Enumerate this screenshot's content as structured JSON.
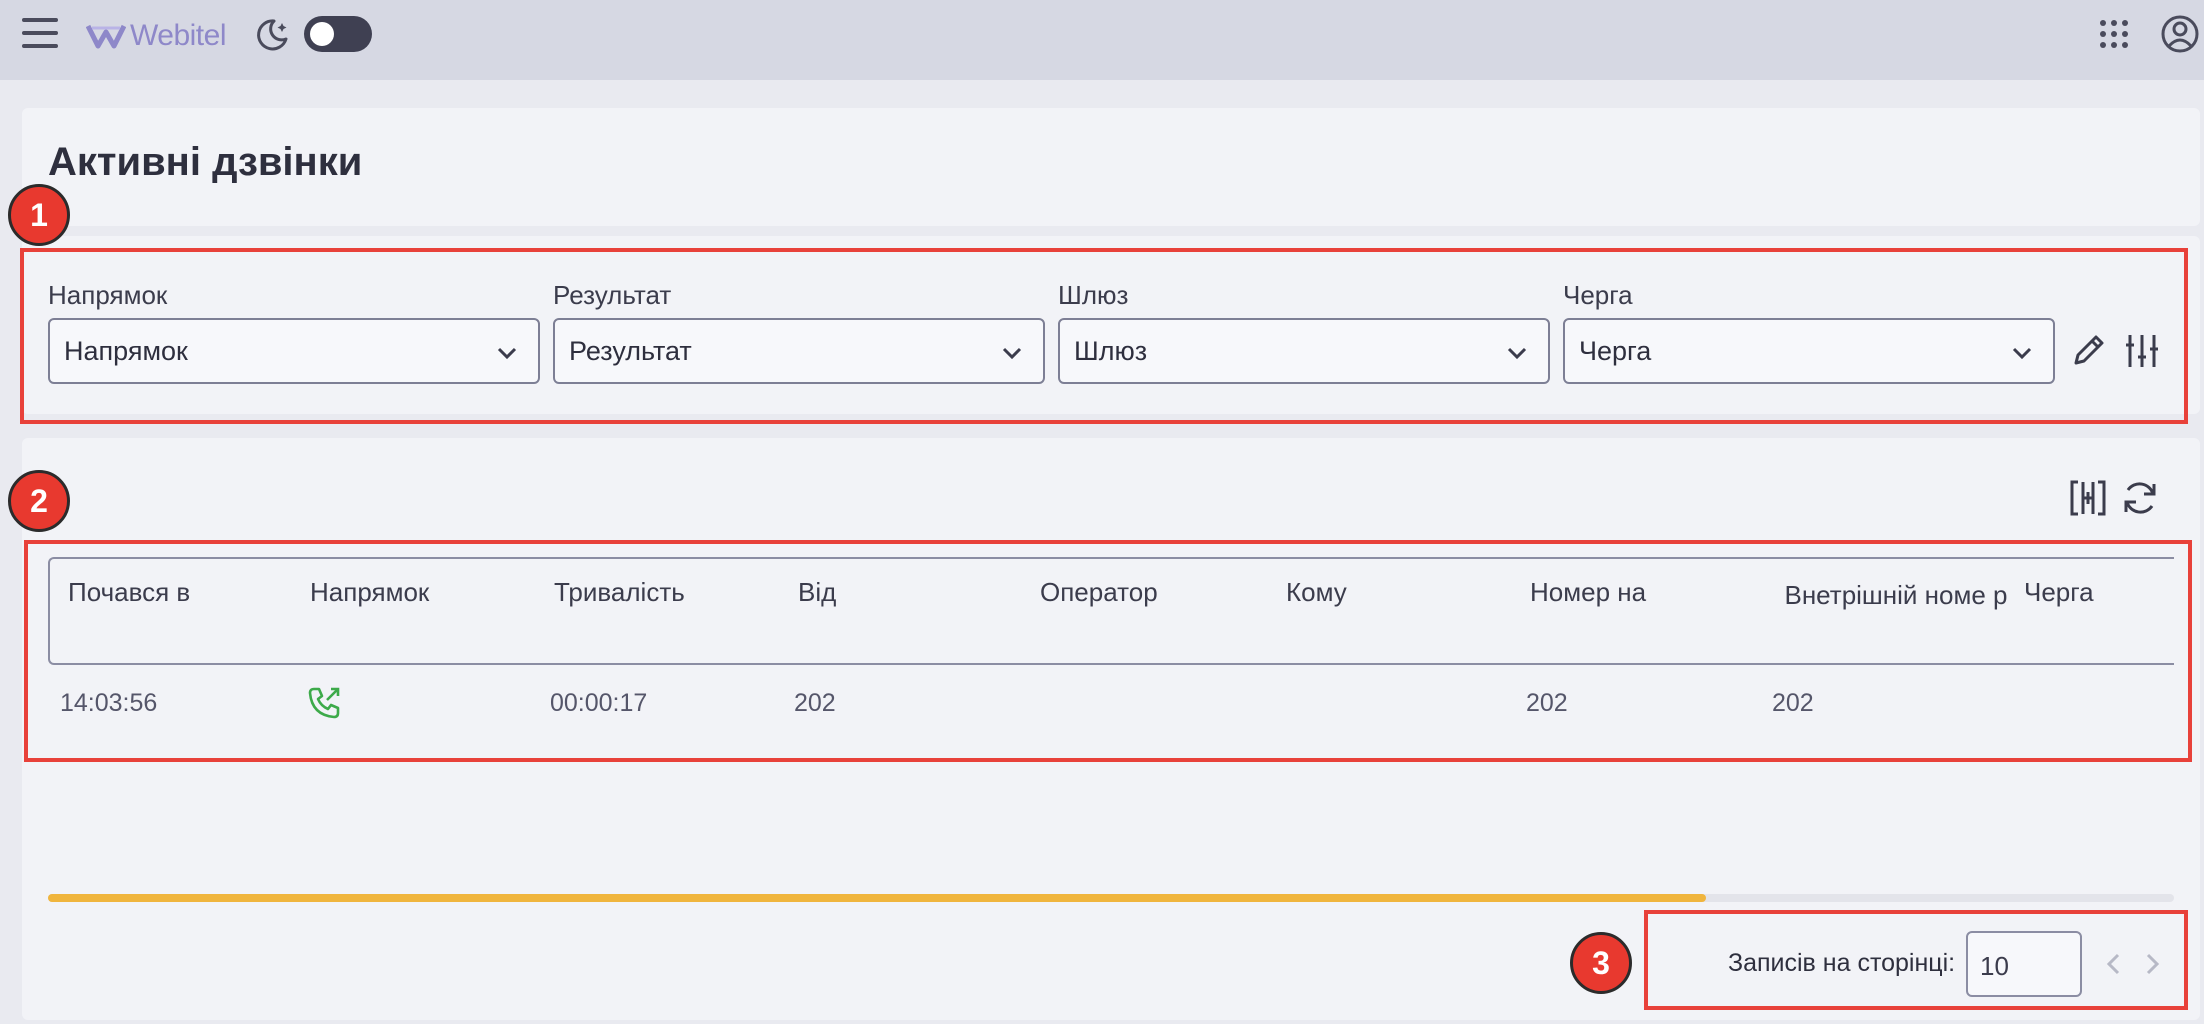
{
  "header": {
    "logo_text": "Webitel",
    "brand_color": "#8e88c9",
    "icons": [
      "menu-icon",
      "moon-icon",
      "apps-icon",
      "user-icon"
    ],
    "theme_toggle_on": false
  },
  "page": {
    "title": "Активні дзвінки"
  },
  "annotations": [
    "1",
    "2",
    "3"
  ],
  "filters": [
    {
      "label": "Напрямок",
      "value": "Напрямок"
    },
    {
      "label": "Результат",
      "value": "Результат"
    },
    {
      "label": "Шлюз",
      "value": "Шлюз"
    },
    {
      "label": "Черга",
      "value": "Черга"
    }
  ],
  "table": {
    "columns": [
      "Почався в",
      "Напрямок",
      "Тривалість",
      "Від",
      "Оператор",
      "Кому",
      "Номер на",
      "Внетрішній номе р",
      "Черга"
    ],
    "rows": [
      {
        "started": "14:03:56",
        "direction_icon": "outbound-call-icon",
        "duration": "00:00:17",
        "from": "202",
        "operator": "",
        "to": "",
        "number": "202",
        "internal": "202",
        "queue": ""
      }
    ]
  },
  "scroll_progress_percent": 78,
  "accent_color": "#f0b53d",
  "annotation_color": "#e8413a",
  "pagination": {
    "label": "Записів на сторінці:",
    "per_page": "10"
  }
}
